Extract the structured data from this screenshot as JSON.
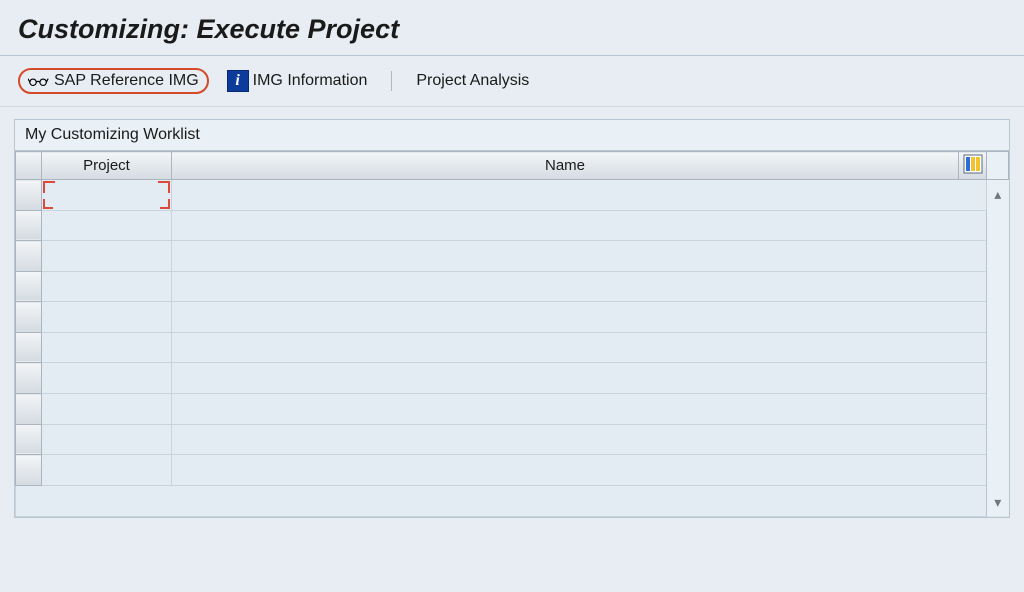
{
  "header": {
    "title": "Customizing: Execute Project"
  },
  "toolbar": {
    "sap_reference_img_label": "SAP Reference IMG",
    "img_information_label": "IMG Information",
    "project_analysis_label": "Project Analysis"
  },
  "panel": {
    "title": "My Customizing Worklist"
  },
  "table": {
    "columns": {
      "project": "Project",
      "name": "Name"
    },
    "rows": [
      {
        "project": "",
        "name": ""
      },
      {
        "project": "",
        "name": ""
      },
      {
        "project": "",
        "name": ""
      },
      {
        "project": "",
        "name": ""
      },
      {
        "project": "",
        "name": ""
      },
      {
        "project": "",
        "name": ""
      },
      {
        "project": "",
        "name": ""
      },
      {
        "project": "",
        "name": ""
      },
      {
        "project": "",
        "name": ""
      },
      {
        "project": "",
        "name": ""
      }
    ]
  }
}
